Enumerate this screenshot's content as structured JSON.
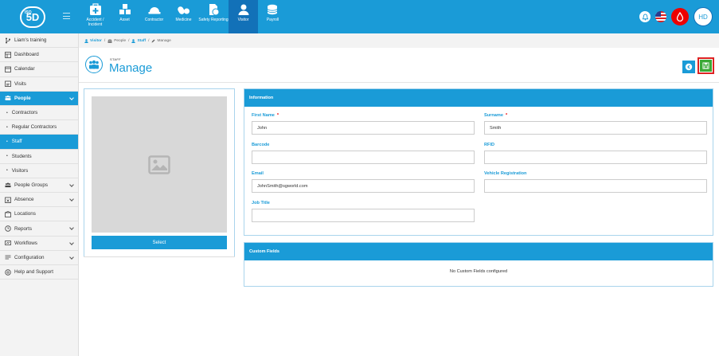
{
  "brand": {
    "logo_text": "5D",
    "logo_sup": "ISO"
  },
  "modules": [
    {
      "label": "Accident / Incident",
      "icon": "first-aid-icon"
    },
    {
      "label": "Asset",
      "icon": "asset-icon"
    },
    {
      "label": "Contractor",
      "icon": "hardhat-icon"
    },
    {
      "label": "Medicine",
      "icon": "pills-icon"
    },
    {
      "label": "Safety Reporting",
      "icon": "report-icon"
    },
    {
      "label": "Visitor",
      "icon": "visitor-icon"
    },
    {
      "label": "Payroll",
      "icon": "coins-icon"
    }
  ],
  "user": {
    "initials": "HD"
  },
  "sidebar": {
    "items": [
      {
        "label": "Liam's training",
        "icon": "branch-icon"
      },
      {
        "label": "Dashboard",
        "icon": "dashboard-icon"
      },
      {
        "label": "Calendar",
        "icon": "calendar-icon"
      },
      {
        "label": "Visits",
        "icon": "visits-icon"
      },
      {
        "label": "People",
        "icon": "people-icon"
      },
      {
        "label": "Contractors"
      },
      {
        "label": "Regular Contractors"
      },
      {
        "label": "Staff"
      },
      {
        "label": "Students"
      },
      {
        "label": "Visitors"
      },
      {
        "label": "People Groups",
        "icon": "groups-icon"
      },
      {
        "label": "Absence",
        "icon": "absence-icon"
      },
      {
        "label": "Locations",
        "icon": "locations-icon"
      },
      {
        "label": "Reports",
        "icon": "reports-icon"
      },
      {
        "label": "Workflows",
        "icon": "workflows-icon"
      },
      {
        "label": "Configuration",
        "icon": "config-icon"
      },
      {
        "label": "Help and Support",
        "icon": "help-icon"
      }
    ]
  },
  "breadcrumb": {
    "visitor": "Visitor",
    "people": "People",
    "staff": "Staff",
    "manage": "Manage",
    "sep": "/"
  },
  "page": {
    "kicker": "STAFF",
    "title": "Manage"
  },
  "photo": {
    "select_label": "Select"
  },
  "information": {
    "title": "Information",
    "first_name": {
      "label": "First Name",
      "value": "John",
      "required": "*"
    },
    "surname": {
      "label": "Surname",
      "value": "Smith",
      "required": "*"
    },
    "barcode": {
      "label": "Barcode",
      "value": ""
    },
    "rfid": {
      "label": "RFID",
      "value": ""
    },
    "email": {
      "label": "Email",
      "value": "JohnSmith@sgworld.com"
    },
    "vehicle": {
      "label": "Vehicle Registration",
      "value": ""
    },
    "job_title": {
      "label": "Job Title",
      "value": ""
    }
  },
  "custom_fields": {
    "title": "Custom Fields",
    "empty_text": "No Custom Fields configured"
  },
  "colors": {
    "primary": "#1a9bd7",
    "active_module": "#1271b8",
    "save": "#3aa935",
    "alert": "#e00000"
  }
}
